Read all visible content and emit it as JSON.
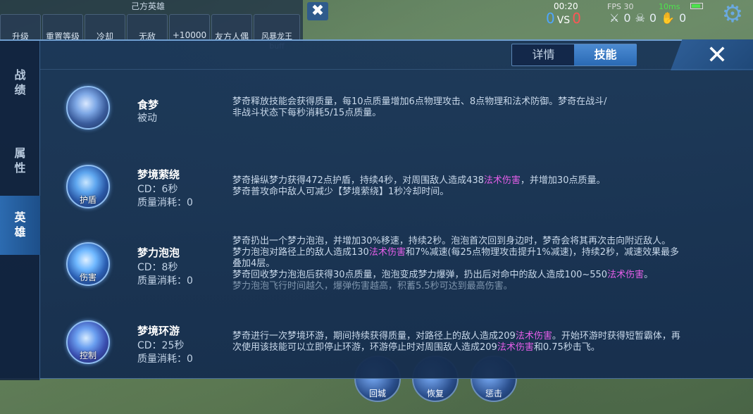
{
  "background": {
    "top_title": "己方英雄",
    "cheat_buttons": [
      "升级",
      "重置等级",
      "冷却",
      "无敌",
      "+10000",
      "友方人偶",
      "风暴龙王buff"
    ],
    "close_top": "✖"
  },
  "hud": {
    "time": "00:20",
    "score_blue": "0",
    "vs": "VS",
    "score_red": "0",
    "fps": "FPS 30",
    "ping": "10ms",
    "kills": "0",
    "deaths": "0",
    "assists": "0"
  },
  "side_tabs": [
    {
      "label": "战\n绩",
      "active": false
    },
    {
      "label": "属\n性",
      "active": false
    },
    {
      "label": "英\n雄",
      "active": true
    }
  ],
  "tabs": [
    {
      "label": "详情",
      "active": false
    },
    {
      "label": "技能",
      "active": true
    }
  ],
  "close_label": "✕",
  "skills": [
    {
      "name": "食梦",
      "type": "被动",
      "badge": "",
      "cd": "",
      "cost": "",
      "desc_lines": [
        [
          {
            "t": "梦奇释放技能会获得质量，每10点质量增加6点物理攻击、8点物理和法术防御。梦奇在战斗/"
          }
        ],
        [
          {
            "t": "非战斗状态下每秒消耗5/15点质量。"
          }
        ]
      ]
    },
    {
      "name": "梦境萦绕",
      "type": "",
      "badge": "护盾",
      "cd": "CD：6秒",
      "cost": "质量消耗：0",
      "desc_lines": [
        [
          {
            "t": "梦奇操纵梦力获得472点护盾，持续4秒，对周围敌人造成438"
          },
          {
            "t": "法术伤害",
            "h": true
          },
          {
            "t": "，并增加30点质量。"
          }
        ],
        [
          {
            "t": "梦奇普攻命中敌人可减少【梦境萦绕】1秒冷却时间。"
          }
        ]
      ]
    },
    {
      "name": "梦力泡泡",
      "type": "",
      "badge": "伤害",
      "cd": "CD：8秒",
      "cost": "质量消耗：0",
      "desc_lines": [
        [
          {
            "t": "梦奇扔出一个梦力泡泡，并增加30%移速，持续2秒。泡泡首次回到身边时，梦奇会将其再次击向附近敌人。"
          }
        ],
        [
          {
            "t": "梦力泡泡对路径上的敌人造成130"
          },
          {
            "t": "法术伤害",
            "h": true
          },
          {
            "t": "和7%减速(每25点物理攻击提升1%减速)，持续2秒，减速效果最多"
          }
        ],
        [
          {
            "t": "叠加4层。"
          }
        ],
        [
          {
            "t": "梦奇回收梦力泡泡后获得30点质量，泡泡变成梦力爆弹，扔出后对命中的敌人造成100~550"
          },
          {
            "t": "法术伤害",
            "h": true
          },
          {
            "t": "。"
          }
        ],
        [
          {
            "t": "梦力泡泡飞行时间越久，爆弹伤害越高，积蓄5.5秒可达到最高伤害。",
            "f": true
          }
        ]
      ]
    },
    {
      "name": "梦境环游",
      "type": "",
      "badge": "控制",
      "cd": "CD：25秒",
      "cost": "质量消耗：0",
      "desc_lines": [
        [
          {
            "t": "梦奇进行一次梦境环游，期间持续获得质量，对路径上的敌人造成209"
          },
          {
            "t": "法术伤害",
            "h": true
          },
          {
            "t": "。开始环游时获得短暂霸体，再"
          }
        ],
        [
          {
            "t": "次使用该技能可以立即停止环游，环游停止时对周围敌人造成209"
          },
          {
            "t": "法术伤害",
            "h": true
          },
          {
            "t": "和0.75秒击飞。"
          }
        ]
      ]
    }
  ],
  "bottom_skills": [
    "回城",
    "恢复",
    "惩击"
  ],
  "colors": {
    "panel": "#183458",
    "active_tab": "#2a6ab5",
    "highlight": "#e45ee8",
    "icon_ring": "#8fbdf0"
  }
}
